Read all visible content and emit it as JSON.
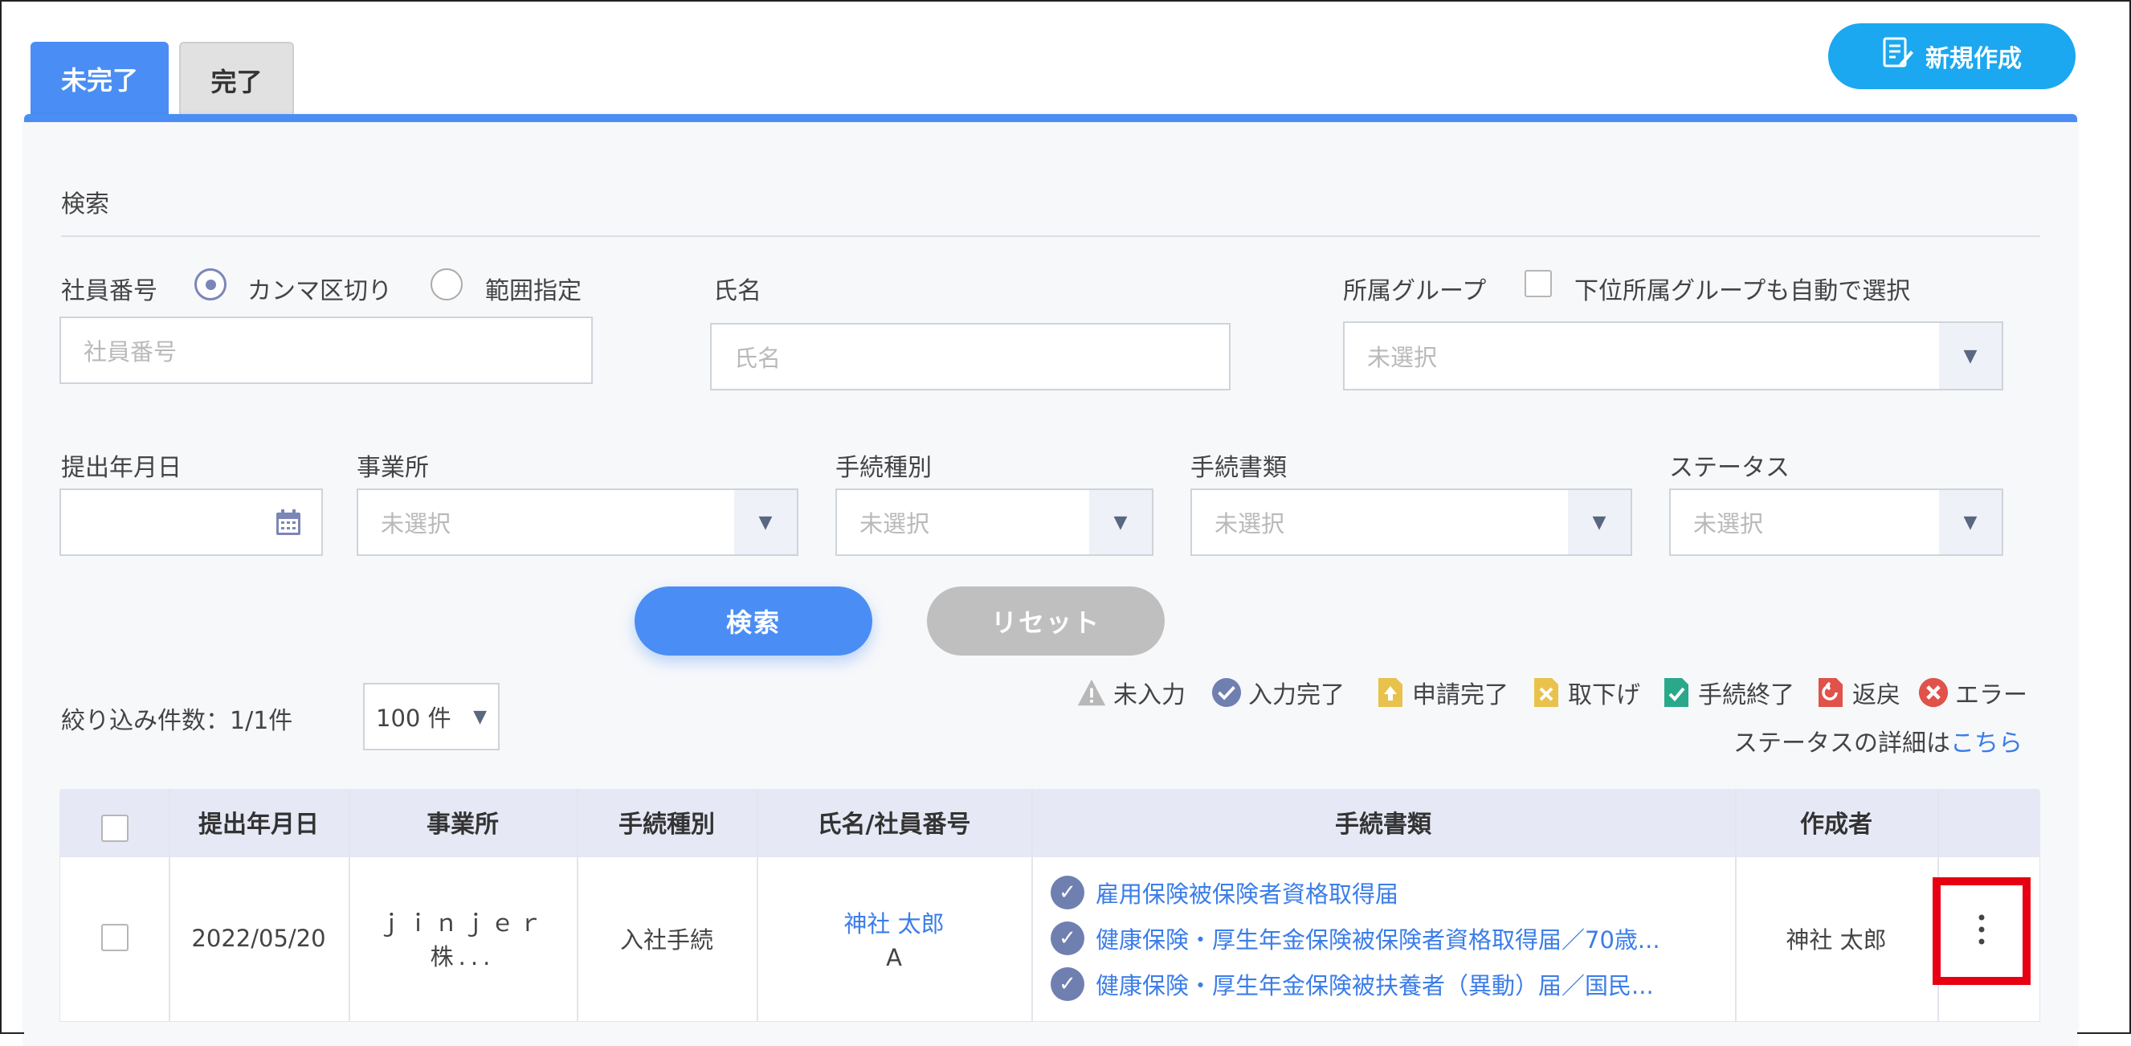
{
  "tabs": [
    {
      "label": "未完了",
      "active": true
    },
    {
      "label": "完了",
      "active": false
    }
  ],
  "new_button": {
    "label": "新規作成",
    "icon": "edit-document-icon"
  },
  "search": {
    "heading": "検索",
    "employee_number": {
      "label": "社員番号",
      "radio_comma": "カンマ区切り",
      "radio_range": "範囲指定",
      "placeholder": "社員番号"
    },
    "name": {
      "label": "氏名",
      "placeholder": "氏名"
    },
    "group": {
      "label": "所属グループ",
      "checkbox_label": "下位所属グループも自動で選択",
      "value": "未選択"
    },
    "submit_date": {
      "label": "提出年月日",
      "icon": "calendar-icon"
    },
    "office": {
      "label": "事業所",
      "value": "未選択"
    },
    "procedure_type": {
      "label": "手続種別",
      "value": "未選択"
    },
    "procedure_doc": {
      "label": "手続書類",
      "value": "未選択"
    },
    "status": {
      "label": "ステータス",
      "value": "未選択"
    },
    "search_button": "検索",
    "reset_button": "リセット"
  },
  "results": {
    "count_text": "絞り込み件数：1/1件",
    "page_size": "100 件",
    "status_detail_prefix": "ステータスの詳細は",
    "status_detail_link": "こちら"
  },
  "legend": [
    {
      "label": "未入力",
      "icon": "warning-icon",
      "color": "#b8b8b8"
    },
    {
      "label": "入力完了",
      "icon": "check-circle-icon",
      "color": "#6f7fb0"
    },
    {
      "label": "申請完了",
      "icon": "doc-up-icon",
      "color": "#e8c24c"
    },
    {
      "label": "取下げ",
      "icon": "doc-x-icon",
      "color": "#e8c24c"
    },
    {
      "label": "手続終了",
      "icon": "doc-check-icon",
      "color": "#2aa98a"
    },
    {
      "label": "返戻",
      "icon": "doc-return-icon",
      "color": "#e0524a"
    },
    {
      "label": "エラー",
      "icon": "error-icon",
      "color": "#e0524a"
    }
  ],
  "table": {
    "headers": [
      "提出年月日",
      "事業所",
      "手続種別",
      "氏名/社員番号",
      "手続書類",
      "作成者"
    ],
    "rows": [
      {
        "date": "2022/05/20",
        "office": "ｊｉｎｊｅｒ株...",
        "type": "入社手続",
        "name": "神社 太郎",
        "employee_no": "A",
        "documents": [
          "雇用保険被保険者資格取得届",
          "健康保険・厚生年金保険被保険者資格取得届／70歳...",
          "健康保険・厚生年金保険被扶養者（異動）届／国民..."
        ],
        "creator": "神社 太郎",
        "menu_icon": "more-vertical-icon"
      }
    ]
  },
  "colors": {
    "accent": "#4a8ef5",
    "new_button": "#1ba8f0",
    "reset": "#bfbfbf",
    "highlight": "#e60012",
    "link": "#3b7de8"
  }
}
